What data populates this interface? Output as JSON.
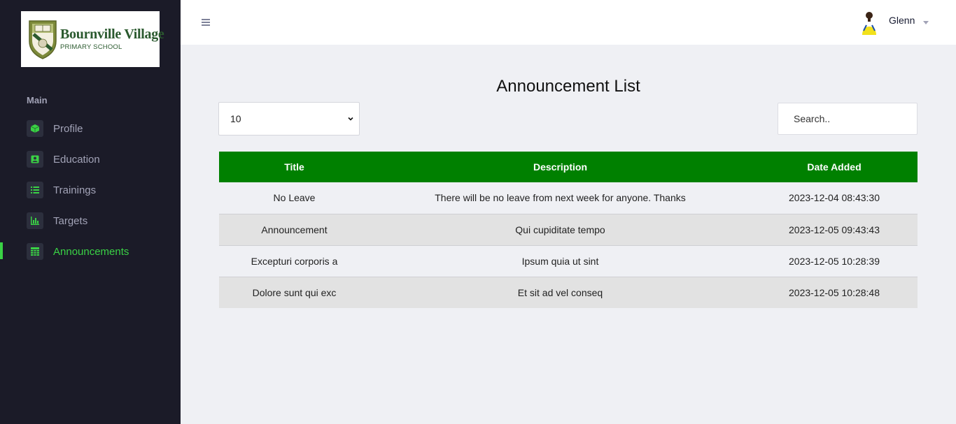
{
  "brand": {
    "name": "Bournville Village",
    "subtitle": "PRIMARY SCHOOL",
    "color": "#2b5a2f"
  },
  "sidebar": {
    "section_label": "Main",
    "items": [
      {
        "label": "Profile",
        "icon": "cube-icon",
        "active": false
      },
      {
        "label": "Education",
        "icon": "id-card-icon",
        "active": false
      },
      {
        "label": "Trainings",
        "icon": "list-icon",
        "active": false
      },
      {
        "label": "Targets",
        "icon": "bar-chart-icon",
        "active": false
      },
      {
        "label": "Announcements",
        "icon": "calendar-grid-icon",
        "active": true
      }
    ],
    "accent": "#3ad245"
  },
  "topbar": {
    "menu_icon": "hamburger-icon",
    "user_name": "Glenn"
  },
  "main": {
    "title": "Announcement List",
    "page_length": "10",
    "search_placeholder": "Search..",
    "table": {
      "header_color": "#008000",
      "columns": [
        "Title",
        "Description",
        "Date Added"
      ],
      "rows": [
        [
          "No Leave",
          "There will be no leave from next week for anyone. Thanks",
          "2023-12-04 08:43:30"
        ],
        [
          "Announcement",
          "Qui cupiditate tempo",
          "2023-12-05 09:43:43"
        ],
        [
          "Excepturi corporis a",
          "Ipsum quia ut sint",
          "2023-12-05 10:28:39"
        ],
        [
          "Dolore sunt qui exc",
          "Et sit ad vel conseq",
          "2023-12-05 10:28:48"
        ]
      ]
    }
  }
}
